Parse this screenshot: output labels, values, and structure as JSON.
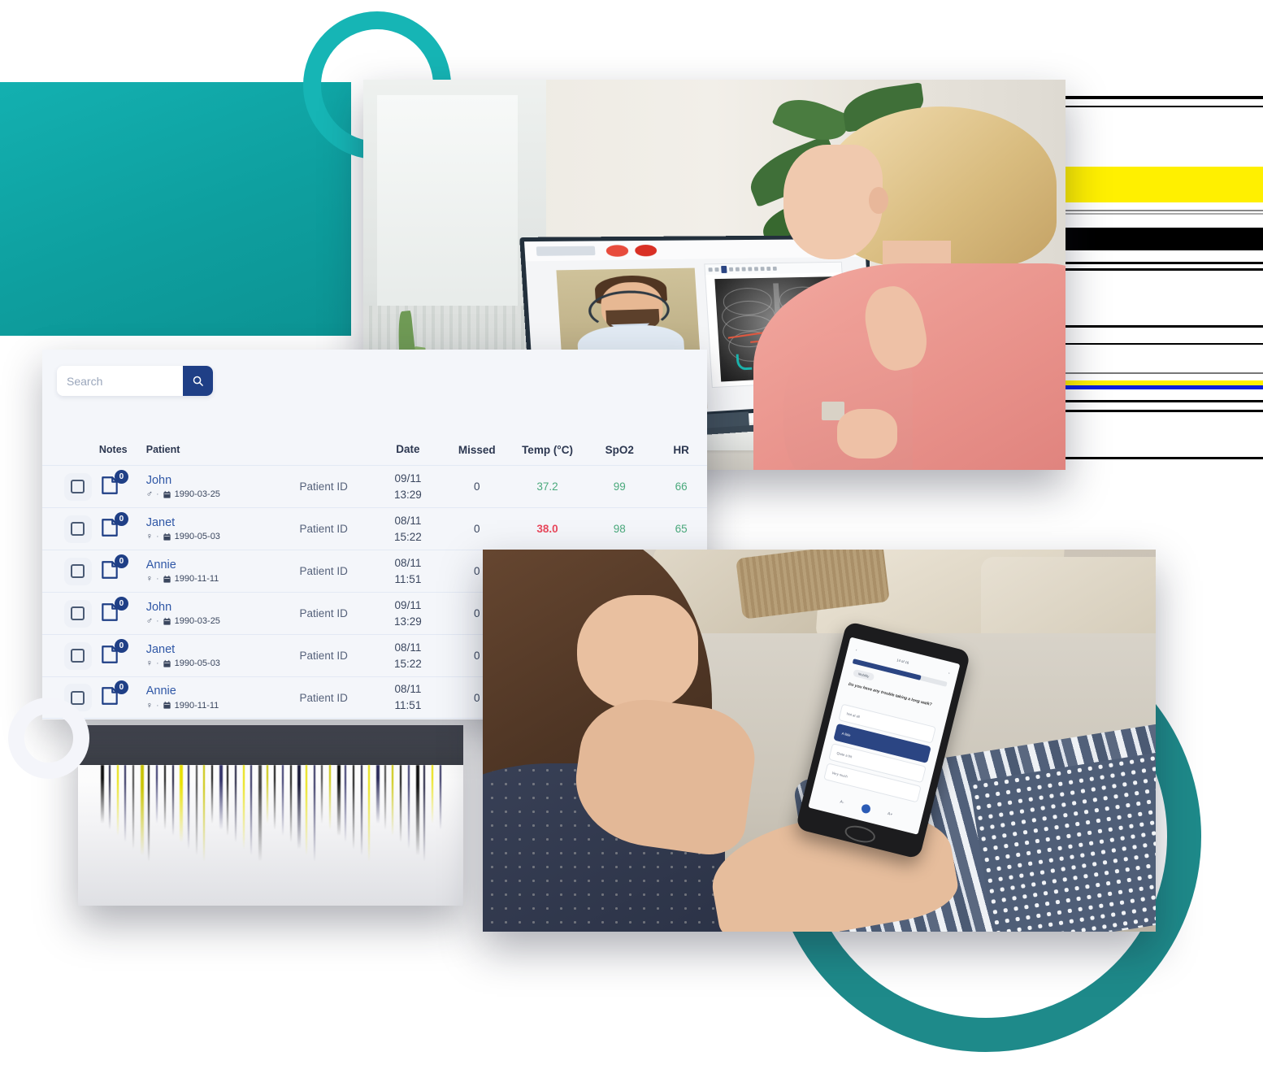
{
  "search": {
    "placeholder": "Search",
    "value": "",
    "icon": "search-icon",
    "button_label": ""
  },
  "table": {
    "columns": [
      "Notes",
      "Patient",
      "",
      "Date",
      "Missed",
      "Temp (°C)",
      "SpO2",
      "HR"
    ],
    "headers": {
      "notes": "Notes",
      "patient": "Patient",
      "patient_id": "",
      "date": "Date",
      "missed": "Missed",
      "temp": "Temp (°C)",
      "spo2": "SpO2",
      "hr": "HR"
    },
    "rows": [
      {
        "notes_count": "0",
        "name": "John",
        "gender": "♂",
        "dob": "1990-03-25",
        "patient_id": "Patient ID",
        "date": "09/11",
        "time": "13:29",
        "missed": "0",
        "temp": "37.2",
        "temp_state": "normal",
        "spo2": "99",
        "hr": "66"
      },
      {
        "notes_count": "0",
        "name": "Janet",
        "gender": "♀",
        "dob": "1990-05-03",
        "patient_id": "Patient ID",
        "date": "08/11",
        "time": "15:22",
        "missed": "0",
        "temp": "38.0",
        "temp_state": "elevated",
        "spo2": "98",
        "hr": "65"
      },
      {
        "notes_count": "0",
        "name": "Annie",
        "gender": "♀",
        "dob": "1990-11-11",
        "patient_id": "Patient ID",
        "date": "08/11",
        "time": "11:51",
        "missed": "0",
        "temp": "",
        "temp_state": "hidden",
        "spo2": "",
        "hr": ""
      },
      {
        "notes_count": "0",
        "name": "John",
        "gender": "♂",
        "dob": "1990-03-25",
        "patient_id": "Patient ID",
        "date": "09/11",
        "time": "13:29",
        "missed": "0",
        "temp": "",
        "temp_state": "hidden",
        "spo2": "",
        "hr": ""
      },
      {
        "notes_count": "0",
        "name": "Janet",
        "gender": "♀",
        "dob": "1990-05-03",
        "patient_id": "Patient ID",
        "date": "08/11",
        "time": "15:22",
        "missed": "0",
        "temp": "",
        "temp_state": "hidden",
        "spo2": "",
        "hr": ""
      },
      {
        "notes_count": "0",
        "name": "Annie",
        "gender": "♀",
        "dob": "1990-11-11",
        "patient_id": "Patient ID",
        "date": "08/11",
        "time": "11:51",
        "missed": "0",
        "temp": "",
        "temp_state": "hidden",
        "spo2": "",
        "hr": ""
      }
    ]
  },
  "photos": {
    "desktop": {
      "alt": "Woman at desk in video consultation with doctor on monitor",
      "screen": {
        "participants": [
          "doctor-with-headset",
          "patient-self-view"
        ],
        "shared_content": "chest-x-ray-with-annotations"
      }
    },
    "phone": {
      "alt": "Woman on sofa answering questionnaire on smartphone",
      "screen": {
        "pager": "14 of 16",
        "chip": "Mobility",
        "question": "Do you have any trouble taking a long walk?",
        "options": [
          "Not at all",
          "A little",
          "Quite a bit",
          "Very much"
        ],
        "selected_option": "A little",
        "font_smaller": "A-",
        "font_larger": "A+"
      }
    },
    "strip": {
      "alt": "partially rendered image card"
    }
  },
  "decor": {
    "teal_square": "#0e9f9f",
    "ring_top": "#16b5b5",
    "arc_bottom_right": "#1e8a8a",
    "ring_bottom_left": "#f4f5fa"
  },
  "colors": {
    "accent_navy": "#1f3f86",
    "link_blue": "#2f57a6",
    "teal": "#13b0b0",
    "value_normal": "#4aa97c",
    "value_alert": "#e9485c",
    "card_bg": "#f4f6fa"
  }
}
